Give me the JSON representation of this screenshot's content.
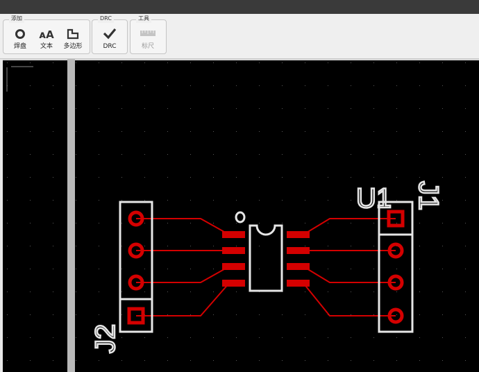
{
  "toolbar": {
    "groups": [
      {
        "title": "添加",
        "tools": [
          {
            "label": "焊盘",
            "icon": "ring-icon"
          },
          {
            "label": "文本",
            "icon": "text-icon"
          },
          {
            "label": "多边形",
            "icon": "polygon-icon"
          }
        ]
      },
      {
        "title": "DRC",
        "tools": [
          {
            "label": "DRC",
            "icon": "check-icon"
          }
        ]
      },
      {
        "title": "工具",
        "tools": [
          {
            "label": "标尺",
            "icon": "ruler-icon",
            "disabled": true
          }
        ]
      }
    ]
  },
  "board": {
    "colors": {
      "copper": "#d40000",
      "silk": "#e6e6e6",
      "background": "#000000",
      "grid": "#555555"
    },
    "designators": {
      "u1": "U1",
      "j1": "J1",
      "j2": "J2"
    },
    "pin1_marker": "0"
  }
}
